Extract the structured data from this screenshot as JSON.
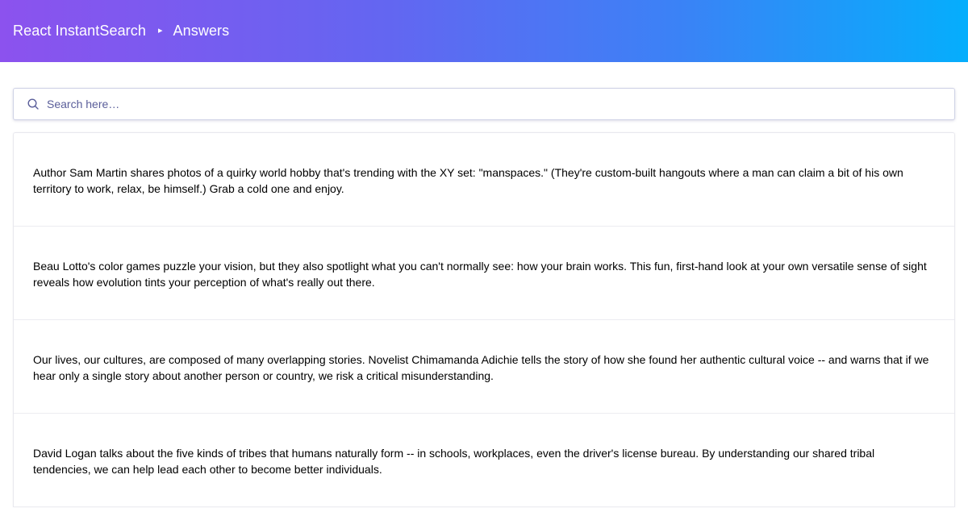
{
  "header": {
    "title": "React InstantSearch",
    "separator": "▸",
    "current": "Answers"
  },
  "search": {
    "icon": "search-icon",
    "value": "",
    "placeholder": "Search here…"
  },
  "hits": [
    {
      "text": "Author Sam Martin shares photos of a quirky world hobby that's trending with the XY set: \"manspaces.\" (They're custom-built hangouts where a man can claim a bit of his own territory to work, relax, be himself.) Grab a cold one and enjoy."
    },
    {
      "text": "Beau Lotto's color games puzzle your vision, but they also spotlight what you can't normally see: how your brain works. This fun, first-hand look at your own versatile sense of sight reveals how evolution tints your perception of what's really out there."
    },
    {
      "text": "Our lives, our cultures, are composed of many overlapping stories. Novelist Chimamanda Adichie tells the story of how she found her authentic cultural voice -- and warns that if we hear only a single story about another person or country, we risk a critical misunderstanding."
    },
    {
      "text": "David Logan talks about the five kinds of tribes that humans naturally form -- in schools, workplaces, even the driver's license bureau. By understanding our shared tribal tendencies, we can help lead each other to become better individuals."
    }
  ],
  "colors": {
    "header_gradient_start": "#8c52ee",
    "header_gradient_end": "#05aefc",
    "placeholder": "#5a5e9a",
    "border": "#e8e8ee"
  }
}
